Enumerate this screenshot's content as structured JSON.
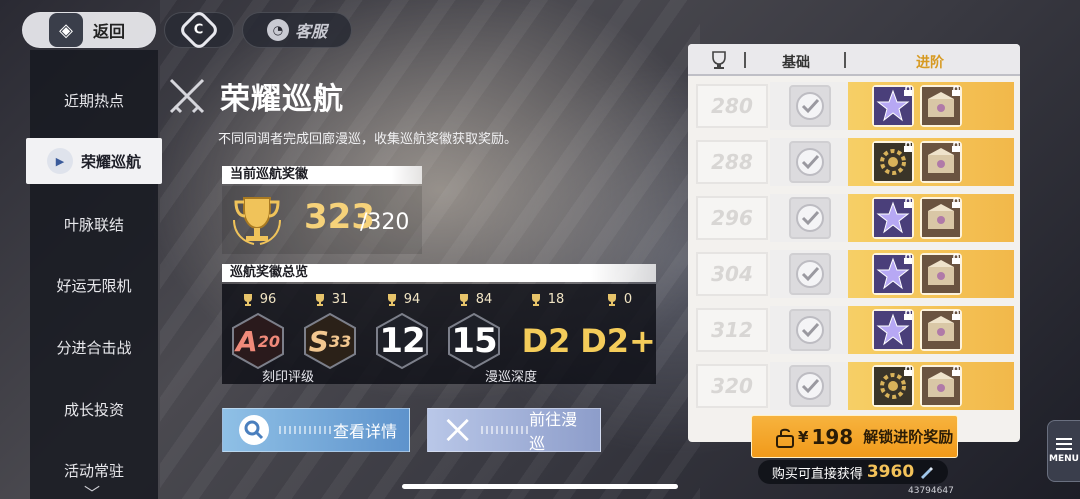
{
  "topbar": {
    "back_label": "返回",
    "service_label": "客服"
  },
  "nav": {
    "items": [
      {
        "label": "近期热点",
        "active": false
      },
      {
        "label": "荣耀巡航",
        "active": true
      },
      {
        "label": "叶脉联结",
        "active": false
      },
      {
        "label": "好运无限机",
        "active": false
      },
      {
        "label": "分进合击战",
        "active": false
      },
      {
        "label": "成长投资",
        "active": false
      },
      {
        "label": "活动常驻",
        "active": false
      }
    ]
  },
  "main": {
    "title": "荣耀巡航",
    "subtitle": "不同同调者完成回廊漫巡，收集巡航奖徽获取奖励。",
    "current_section": "当前巡航奖徽",
    "current_value": "323",
    "current_max": "/320",
    "overview_section": "巡航奖徽总览",
    "overview": [
      {
        "count": "96",
        "badge": "A",
        "badge_num": "20",
        "style": "red"
      },
      {
        "count": "31",
        "badge": "S",
        "badge_num": "33",
        "style": "bronze"
      },
      {
        "count": "94",
        "badge": "12",
        "badge_num": "",
        "style": "plain"
      },
      {
        "count": "84",
        "badge": "15",
        "badge_num": "",
        "style": "plain"
      },
      {
        "count": "18",
        "badge": "D2",
        "badge_num": "",
        "style": "gold"
      },
      {
        "count": "0",
        "badge": "D2+",
        "badge_num": "",
        "style": "gold"
      }
    ],
    "caption_left": "刻印评级",
    "caption_right": "漫巡深度",
    "detail_button": "查看详情",
    "go_button": "前往漫巡"
  },
  "rewards": {
    "header_basic": "基础",
    "header_advanced": "进阶",
    "rows": [
      {
        "level": "280",
        "adv_icon": "purple-star"
      },
      {
        "level": "288",
        "adv_icon": "gold-gear"
      },
      {
        "level": "296",
        "adv_icon": "purple-star"
      },
      {
        "level": "304",
        "adv_icon": "purple-star"
      },
      {
        "level": "312",
        "adv_icon": "purple-star"
      },
      {
        "level": "320",
        "adv_icon": "gold-gear"
      }
    ],
    "unlock_currency": "¥",
    "unlock_price": "198",
    "unlock_label": "解锁进阶奖励",
    "buy_note": "购买可直接获得",
    "buy_value": "3960",
    "uid": "43794647"
  },
  "menu_label": "MENU",
  "colors": {
    "accent_gold": "#f6d27a",
    "advanced_row": "#f2b84a",
    "detail_button": "#5e93cc",
    "unlock_button": "#f19a1a"
  }
}
